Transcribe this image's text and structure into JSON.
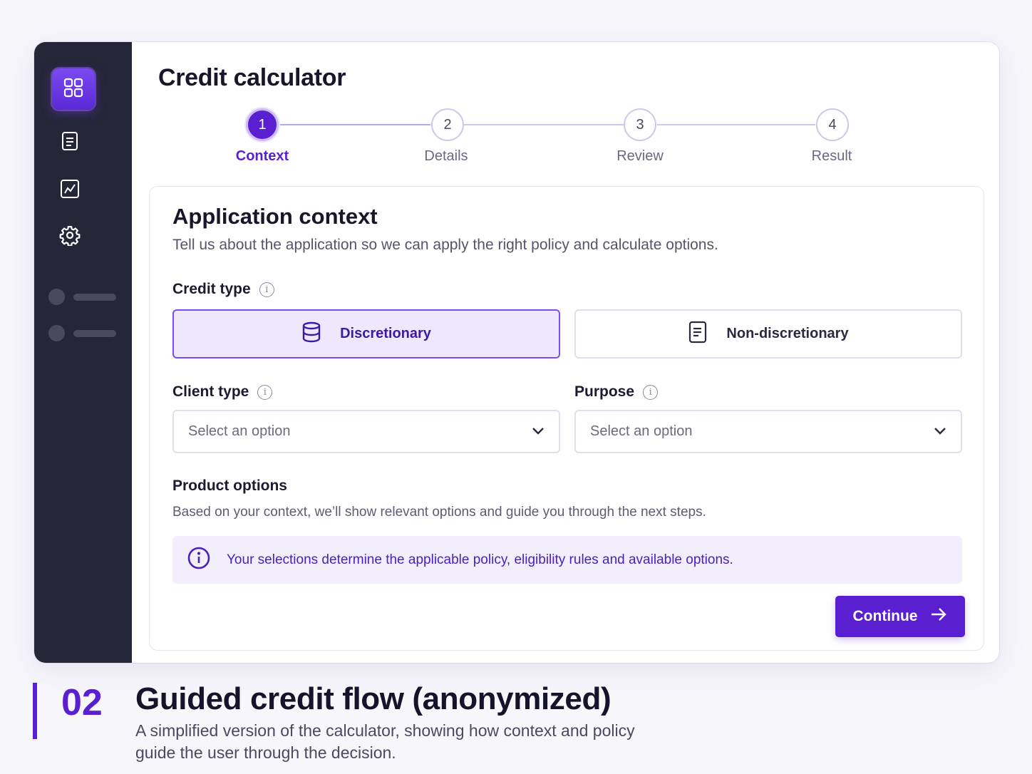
{
  "app": {
    "title": "Credit calculator"
  },
  "sidebar": {
    "items": [
      {
        "icon": "dashboard-grid-icon",
        "active": true
      },
      {
        "icon": "document-icon",
        "active": false
      },
      {
        "icon": "chart-icon",
        "active": false
      },
      {
        "icon": "gear-icon",
        "active": false
      }
    ]
  },
  "stepper": {
    "steps": [
      {
        "number": "1",
        "label": "Context",
        "active": true
      },
      {
        "number": "2",
        "label": "Details",
        "active": false
      },
      {
        "number": "3",
        "label": "Review",
        "active": false
      },
      {
        "number": "4",
        "label": "Result",
        "active": false
      }
    ]
  },
  "form": {
    "title": "Application context",
    "subtitle": "Tell us about the application so we can apply the right policy and calculate options.",
    "credit_type": {
      "label": "Credit type",
      "options": [
        {
          "label": "Discretionary",
          "icon": "database-icon",
          "selected": true
        },
        {
          "label": "Non-discretionary",
          "icon": "document-icon",
          "selected": false
        }
      ]
    },
    "client_type": {
      "label": "Client type",
      "placeholder": "Select an option"
    },
    "purpose": {
      "label": "Purpose",
      "placeholder": "Select an option"
    },
    "product_options": {
      "title": "Product options",
      "subtitle": "Based on your context, we’ll show relevant options and guide you through the next steps."
    },
    "info_banner": "Your selections determine the applicable policy, eligibility rules and available options.",
    "continue_label": "Continue"
  },
  "caption": {
    "number": "02",
    "title": "Guided credit flow (anonymized)",
    "description": "A simplified version of the calculator, showing how context and policy guide the user through the decision."
  },
  "colors": {
    "accent": "#5a1fd0",
    "sidebar_bg": "#262639",
    "selected_bg": "#efe8fd",
    "banner_bg": "#f2eefc"
  }
}
